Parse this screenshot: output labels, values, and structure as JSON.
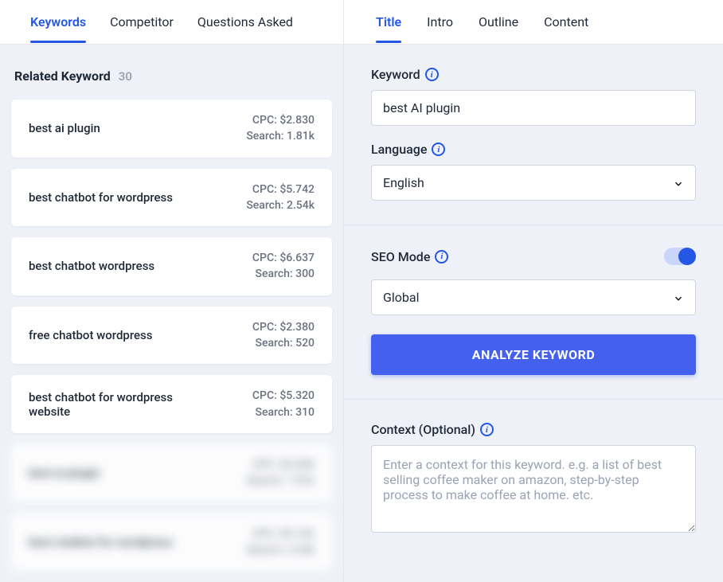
{
  "leftTabs": {
    "keywords": "Keywords",
    "competitor": "Competitor",
    "questions": "Questions Asked"
  },
  "relatedKeyword": {
    "title": "Related Keyword",
    "count": "30",
    "cpcPrefix": "CPC: ",
    "searchPrefix": "Search: ",
    "items": [
      {
        "name": "best ai plugin",
        "cpc": "$2.830",
        "search": "1.81k"
      },
      {
        "name": "best chatbot for wordpress",
        "cpc": "$5.742",
        "search": "2.54k"
      },
      {
        "name": "best chatbot wordpress",
        "cpc": "$6.637",
        "search": "300"
      },
      {
        "name": "free chatbot wordpress",
        "cpc": "$2.380",
        "search": "520"
      },
      {
        "name": "best chatbot for wordpress website",
        "cpc": "$5.320",
        "search": "310"
      },
      {
        "name": "best ai plugin",
        "cpc": "$2.830",
        "search": "1.81k"
      },
      {
        "name": "best chatbot for wordpress",
        "cpc": "$5.742",
        "search": "2.54k"
      }
    ]
  },
  "rightTabs": {
    "title": "Title",
    "intro": "Intro",
    "outline": "Outline",
    "content": "Content"
  },
  "form": {
    "keywordLabel": "Keyword",
    "keywordValue": "best AI plugin",
    "languageLabel": "Language",
    "languageValue": "English",
    "seoModeLabel": "SEO Mode",
    "seoModeScope": "Global",
    "analyzeLabel": "ANALYZE KEYWORD",
    "contextLabel": "Context (Optional)",
    "contextPlaceholder": "Enter a context for this keyword. e.g. a list of best selling coffee maker on amazon, step-by-step process to make coffee at home. etc."
  }
}
